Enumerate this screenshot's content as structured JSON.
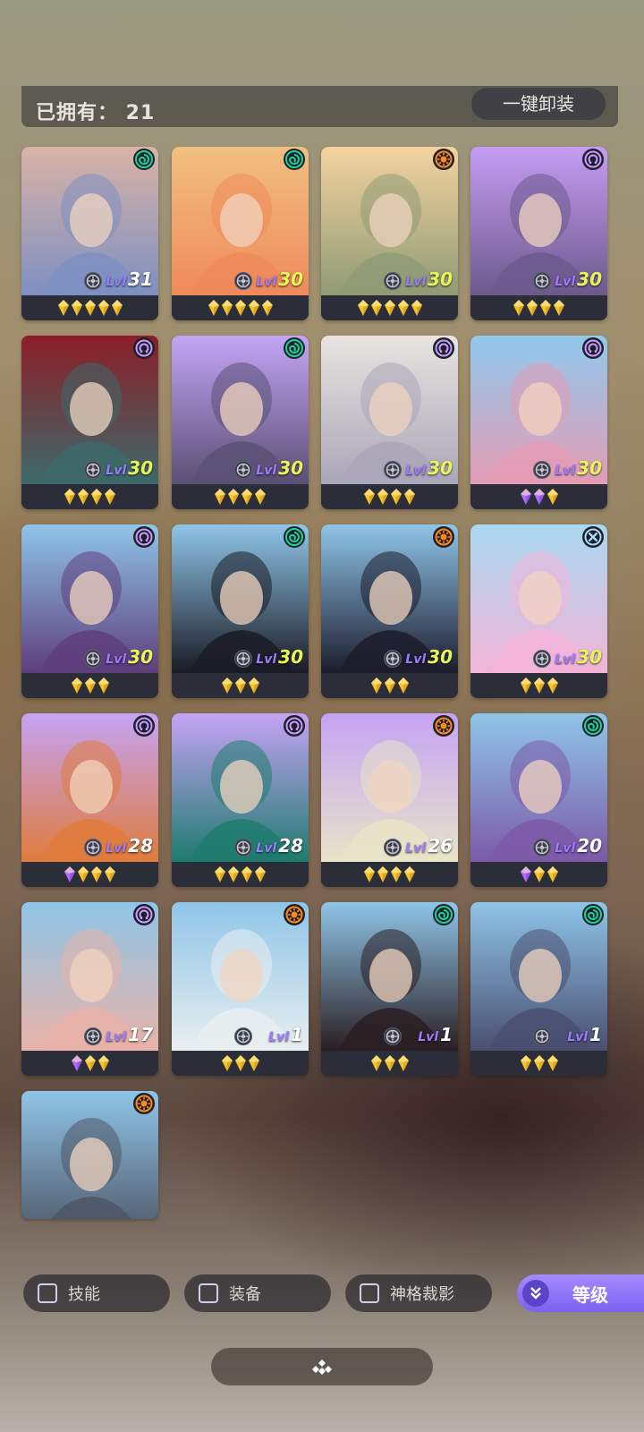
{
  "header": {
    "owned_label": "已拥有： 21",
    "unequip_all_label": "一键卸装"
  },
  "colors": {
    "accent": "#8b6ff5",
    "level_max": "#e8f55a",
    "gem_gold": "#f5c42c",
    "gem_purple": "#b26bff",
    "class_green": "#1dd19a",
    "class_orange": "#ff8a1c",
    "class_purple": "#c99bff",
    "class_blue": "#a8d9ff"
  },
  "cards": [
    {
      "level": "31",
      "level_label": "Lvl",
      "class_icon": "spiral-icon",
      "gems": [
        "gold",
        "gold",
        "gold",
        "gold",
        "gold"
      ],
      "bg": [
        "#d9b3a6",
        "#7e8fc2"
      ]
    },
    {
      "level": "30",
      "level_label": "Lvl",
      "class_icon": "spiral-icon",
      "gems": [
        "gold",
        "gold",
        "gold",
        "gold",
        "gold"
      ],
      "bg": [
        "#f0c080",
        "#f08a5a"
      ]
    },
    {
      "level": "30",
      "level_label": "Lvl",
      "class_icon": "sun-icon",
      "gems": [
        "gold",
        "gold",
        "gold",
        "gold",
        "gold"
      ],
      "bg": [
        "#f3d3a0",
        "#8f9b75"
      ]
    },
    {
      "level": "30",
      "level_label": "Lvl",
      "class_icon": "omega-icon",
      "gems": [
        "gold",
        "gold",
        "gold",
        "gold"
      ],
      "bg": [
        "#c59cf3",
        "#6c5a8c"
      ]
    },
    {
      "level": "30",
      "level_label": "Lvl",
      "class_icon": "omega-icon",
      "gems": [
        "gold",
        "gold",
        "gold",
        "gold"
      ],
      "bg": [
        "#8c1e28",
        "#3d6a6a"
      ]
    },
    {
      "level": "30",
      "level_label": "Lvl",
      "class_icon": "spiral-icon",
      "gems": [
        "gold",
        "gold",
        "gold",
        "gold"
      ],
      "bg": [
        "#c3a5f5",
        "#5a5074"
      ]
    },
    {
      "level": "30",
      "level_label": "Lvl",
      "class_icon": "omega-icon",
      "gems": [
        "gold",
        "gold",
        "gold",
        "gold"
      ],
      "bg": [
        "#e8e4e0",
        "#aaa6b8"
      ]
    },
    {
      "level": "30",
      "level_label": "Lvl",
      "class_icon": "omega-icon",
      "gems": [
        "purple",
        "purple",
        "gold"
      ],
      "bg": [
        "#8fc9ee",
        "#e49cb5"
      ]
    },
    {
      "level": "30",
      "level_label": "Lvl",
      "class_icon": "omega-icon",
      "gems": [
        "gold",
        "gold",
        "gold"
      ],
      "bg": [
        "#8fc5e8",
        "#5e3e7c"
      ]
    },
    {
      "level": "30",
      "level_label": "Lvl",
      "class_icon": "spiral-icon",
      "gems": [
        "gold",
        "gold",
        "gold"
      ],
      "bg": [
        "#8fc5e8",
        "#1a1b24"
      ]
    },
    {
      "level": "30",
      "level_label": "Lvl",
      "class_icon": "sun-icon",
      "gems": [
        "gold",
        "gold",
        "gold"
      ],
      "bg": [
        "#8fc5e8",
        "#1c1c2c"
      ]
    },
    {
      "level": "30",
      "level_label": "Lvl",
      "class_icon": "cross-icon",
      "gems": [
        "gold",
        "gold",
        "gold"
      ],
      "bg": [
        "#a9d8f0",
        "#f3b4d8"
      ]
    },
    {
      "level": "28",
      "level_label": "Lvl",
      "class_icon": "omega-icon",
      "gems": [
        "purple",
        "gold",
        "gold",
        "gold"
      ],
      "bg": [
        "#c5a3f5",
        "#e07b3c"
      ]
    },
    {
      "level": "28",
      "level_label": "Lvl",
      "class_icon": "omega-icon",
      "gems": [
        "gold",
        "gold",
        "gold",
        "gold"
      ],
      "bg": [
        "#c5a3f5",
        "#1f7b6e"
      ]
    },
    {
      "level": "26",
      "level_label": "Lvl",
      "class_icon": "sun-icon",
      "gems": [
        "gold",
        "gold",
        "gold",
        "gold"
      ],
      "bg": [
        "#c5a3f5",
        "#e8e4c8"
      ]
    },
    {
      "level": "20",
      "level_label": "Lvl",
      "class_icon": "spiral-icon",
      "gems": [
        "purple",
        "gold",
        "gold"
      ],
      "bg": [
        "#8fc5e8",
        "#7c5aa8"
      ]
    },
    {
      "level": "17",
      "level_label": "Lvl",
      "class_icon": "omega-icon",
      "gems": [
        "purple",
        "gold",
        "gold"
      ],
      "bg": [
        "#8fc5e8",
        "#e8b2a8"
      ]
    },
    {
      "level": "1",
      "level_label": "Lvl",
      "class_icon": "sun-icon",
      "gems": [
        "gold",
        "gold",
        "gold"
      ],
      "bg": [
        "#8fc5e8",
        "#e9eef0"
      ]
    },
    {
      "level": "1",
      "level_label": "Lvl",
      "class_icon": "spiral-icon",
      "gems": [
        "gold",
        "gold",
        "gold"
      ],
      "bg": [
        "#8fc5e8",
        "#2a1e22"
      ]
    },
    {
      "level": "1",
      "level_label": "Lvl",
      "class_icon": "spiral-icon",
      "gems": [
        "gold",
        "gold",
        "gold"
      ],
      "bg": [
        "#8fc5e8",
        "#4a4f70"
      ]
    },
    {
      "level": "",
      "level_label": "",
      "class_icon": "sun-icon",
      "gems": [],
      "bg": [
        "#8fc5e8",
        "#4e5666"
      ]
    }
  ],
  "filters": {
    "skills_label": "技能",
    "equipment_label": "装备",
    "divinity_label": "神格裁影",
    "sort_label": "等级"
  }
}
